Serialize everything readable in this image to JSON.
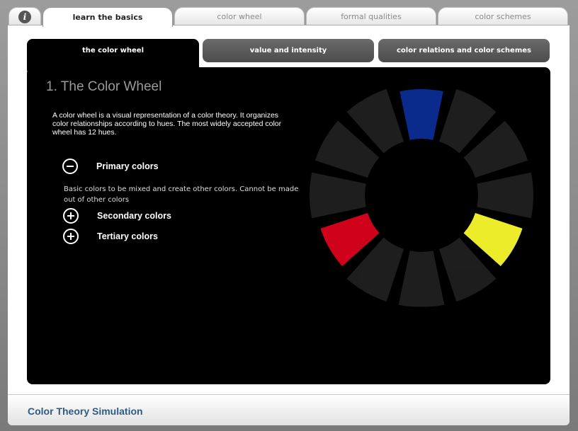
{
  "top_tabs": {
    "info_icon": "i",
    "items": [
      "learn the basics",
      "color wheel",
      "formal qualities",
      "color schemes"
    ]
  },
  "sub_tabs": [
    "the color wheel",
    "value and intensity",
    "color relations and color schemes"
  ],
  "section": {
    "title": "1. The Color Wheel",
    "intro": "A color wheel is a visual representation of a color theory. It organizes color relationships according to hues. The most widely accepted color wheel has 12 hues."
  },
  "accordion": {
    "primary_label": "Primary colors",
    "primary_desc": "Basic colors to be mixed and create other colors. Cannot be made out of other colors",
    "secondary_label": "Secondary colors",
    "tertiary_label": "Tertiary colors"
  },
  "wheel": {
    "segments": 12,
    "highlight_colors": {
      "blue": "#0a2a8c",
      "yellow": "#ecec2a",
      "red": "#d0021b"
    },
    "inactive_color": "#1e1e1e"
  },
  "footer": {
    "title": "Color Theory Simulation"
  },
  "colors": {
    "accent": "#2e5b85"
  }
}
